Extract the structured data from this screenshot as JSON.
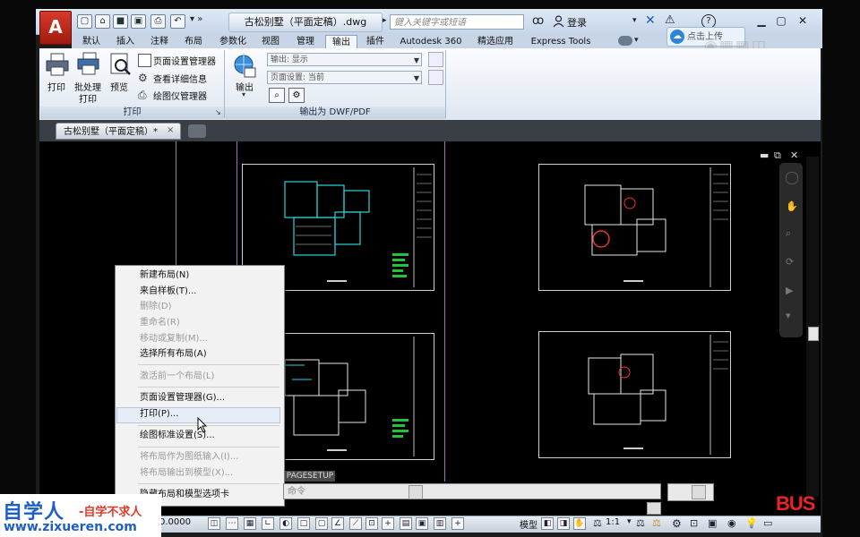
{
  "app": {
    "doc_title": "古松别墅（平面定稿）.dwg",
    "search_placeholder": "键入关键字或短语",
    "login_label": "登录",
    "help_label": "?"
  },
  "menu_tabs": [
    "默认",
    "插入",
    "注释",
    "布局",
    "参数化",
    "视图",
    "管理",
    "输出",
    "插件",
    "Autodesk 360",
    "精选应用",
    "Express Tools"
  ],
  "active_tab": "输出",
  "upload_label": "点击上传",
  "ribbon": {
    "print_panel": {
      "title": "打印",
      "print_label": "打印",
      "batch_label_1": "批处理",
      "batch_label_2": "打印",
      "preview_label": "预览",
      "page_setup_mgr": "页面设置管理器",
      "view_details": "查看详细信息",
      "plotter_mgr": "绘图仪管理器"
    },
    "export_panel": {
      "title": "输出为 DWF/PDF",
      "export_label": "输出",
      "export_combo": "输出: 显示",
      "page_setup_combo": "页面设置: 当前"
    }
  },
  "doc_tab": {
    "label": "古松别墅（平面定稿）*",
    "close": "×"
  },
  "context_menu": {
    "items": [
      {
        "label": "新建布局(N)",
        "enabled": true
      },
      {
        "label": "来自样板(T)...",
        "enabled": true
      },
      {
        "label": "删除(D)",
        "enabled": false
      },
      {
        "label": "重命名(R)",
        "enabled": false
      },
      {
        "label": "移动或复制(M)...",
        "enabled": false
      },
      {
        "label": "选择所有布局(A)",
        "enabled": true
      },
      {
        "label": "激活前一个布局(L)",
        "enabled": false
      },
      {
        "label": "页面设置管理器(G)...",
        "enabled": true
      },
      {
        "label": "打印(P)...",
        "enabled": true
      },
      {
        "label": "绘图标准设置(S)...",
        "enabled": true
      },
      {
        "label": "将布局作为图纸输入(I)...",
        "enabled": false
      },
      {
        "label": "将布局输出到模型(X)...",
        "enabled": false
      },
      {
        "label": "隐藏布局和模型选项卡",
        "enabled": true
      }
    ]
  },
  "command": {
    "last_cmd": "PAGESETUP",
    "prompt": "命令"
  },
  "status": {
    "coords": "0.0000",
    "model_label": "模型",
    "scale_label": "1:1"
  },
  "branding": {
    "name_cn": "自学人",
    "slogan": "-自学不求人",
    "url": "www.zixueren.com",
    "corner_logo": "BUS"
  }
}
